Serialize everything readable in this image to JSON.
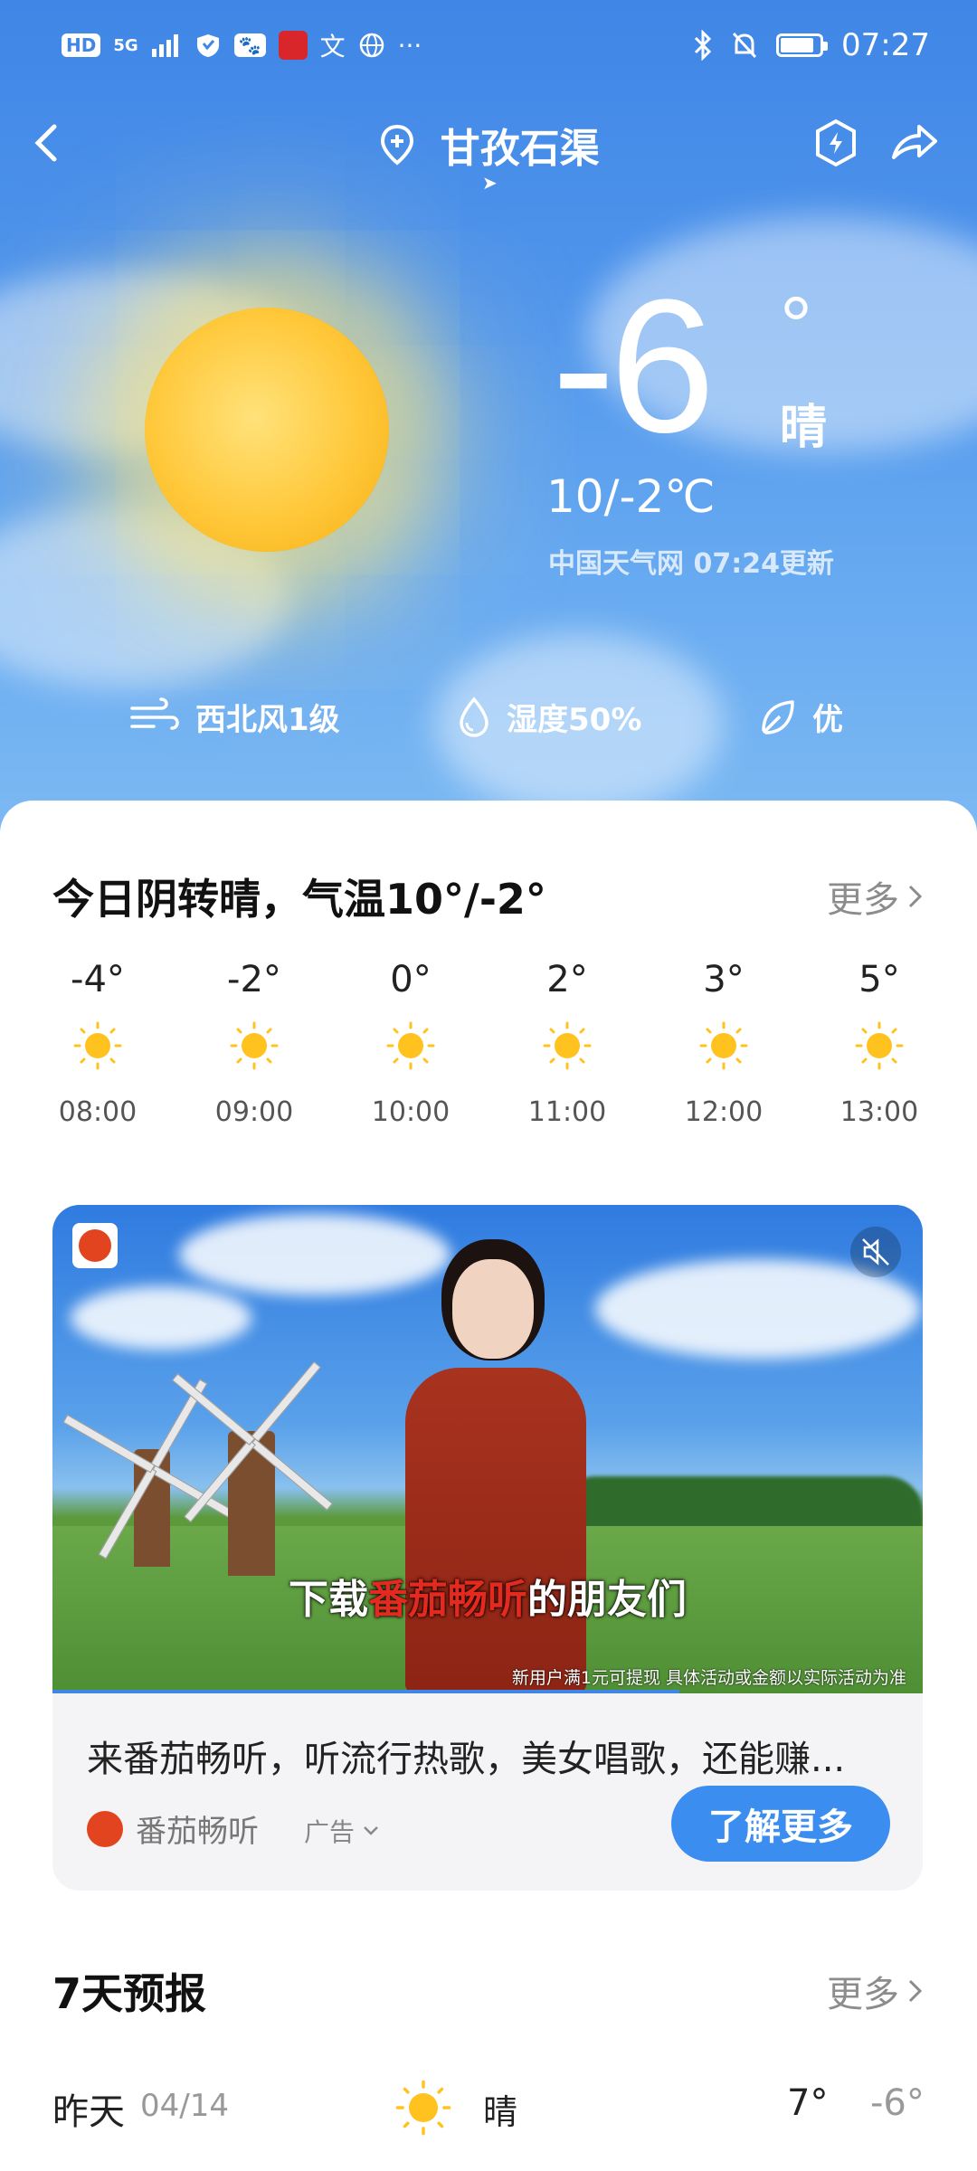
{
  "status_bar": {
    "left_items": [
      "HD",
      "5G",
      "signal",
      "heart-shield",
      "paw",
      "app-badge",
      "文",
      "globe",
      "..."
    ],
    "hd_label": "HD",
    "net_label": "5G",
    "wen_label": "文",
    "more_label": "···",
    "battery_level": 0.85,
    "time": "07:27"
  },
  "header": {
    "location": "甘孜石渠"
  },
  "current": {
    "temperature": "-6",
    "degree": "°",
    "condition": "晴",
    "range": "10/-2℃",
    "source": "中国天气网 07:24更新"
  },
  "metrics": [
    {
      "icon": "wind-icon",
      "label": "西北风1级"
    },
    {
      "icon": "humidity-icon",
      "label": "湿度50%"
    },
    {
      "icon": "leaf-icon",
      "label": "优"
    }
  ],
  "today": {
    "title": "今日阴转晴，气温10°/-2°",
    "more": "更多",
    "hours": [
      {
        "temp": "-4°",
        "time": "08:00",
        "icon": "sun-icon"
      },
      {
        "temp": "-2°",
        "time": "09:00",
        "icon": "sun-icon"
      },
      {
        "temp": "0°",
        "time": "10:00",
        "icon": "sun-icon"
      },
      {
        "temp": "2°",
        "time": "11:00",
        "icon": "sun-icon"
      },
      {
        "temp": "3°",
        "time": "12:00",
        "icon": "sun-icon"
      },
      {
        "temp": "5°",
        "time": "13:00",
        "icon": "sun-icon"
      }
    ]
  },
  "ad": {
    "caption_pre": "下载",
    "caption_highlight": "番茄畅听",
    "caption_post": "的朋友们",
    "fine_print": "新用户满1元可提现 具体活动或金额以实际活动为准",
    "progress": 0.72,
    "description": "来番茄畅听，听流行热歌，美女唱歌，还能赚...",
    "brand": "番茄畅听",
    "tag": "广告",
    "button": "了解更多"
  },
  "forecast": {
    "title": "7天预报",
    "more": "更多",
    "rows": [
      {
        "day": "昨天",
        "date": "04/14",
        "icon": "sun-icon",
        "condition": "晴",
        "high": "7°",
        "low": "-6°"
      }
    ]
  },
  "colors": {
    "sky_top": "#3f86e6",
    "accent": "#3b8ef0",
    "sun": "#ffc83a",
    "ad_highlight": "#e4291e"
  }
}
